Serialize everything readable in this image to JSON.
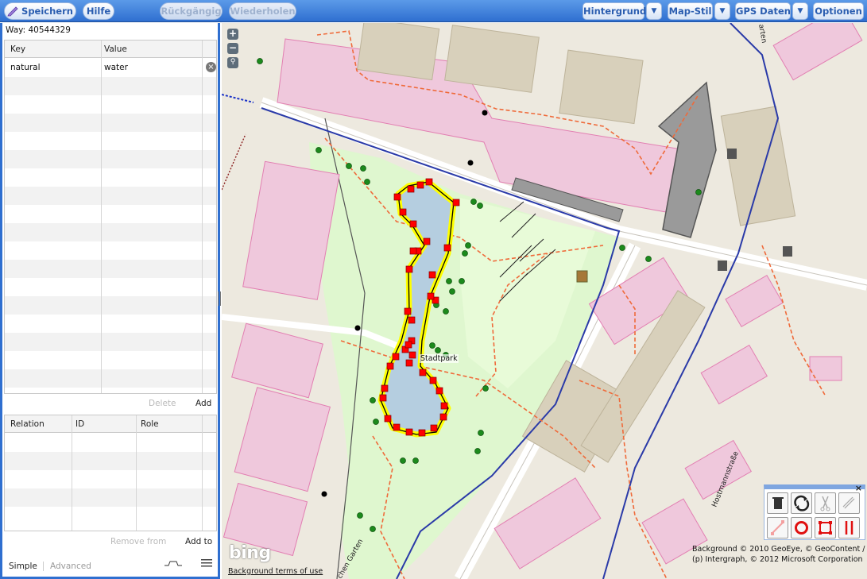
{
  "toolbar": {
    "save_label": "Speichern",
    "help_label": "Hilfe",
    "undo_label": "Rückgängig",
    "redo_label": "Wiederholen",
    "background_label": "Hintergrund",
    "map_style_label": "Map-Stil",
    "gps_label": "GPS Daten",
    "options_label": "Optionen"
  },
  "panel": {
    "way_title": "Way: 40544329",
    "tags": {
      "key_header": "Key",
      "value_header": "Value",
      "rows": [
        {
          "key": "natural",
          "value": "water"
        }
      ],
      "delete_label": "Delete",
      "add_label": "Add"
    },
    "relations": {
      "relation_header": "Relation",
      "id_header": "ID",
      "role_header": "Role",
      "remove_label": "Remove from",
      "add_to_label": "Add to"
    },
    "tabs": {
      "simple": "Simple",
      "advanced": "Advanced"
    }
  },
  "map": {
    "place_label": "Stadtpark",
    "bing_logo": "bing",
    "terms_link": "Background terms of use",
    "attribution": "Background © 2010 GeoEye, © GeoContent / (p) Intergraph, © 2012 Microsoft Corporation",
    "street_labels": [
      "Hostmannstraße",
      "chen Garten",
      "arten"
    ],
    "zoom_in": "+",
    "zoom_out": "−"
  },
  "palette": {
    "close": "×",
    "tools": [
      "trash-icon",
      "reverse-icon",
      "scissors-icon",
      "link-icon",
      "straighten-icon",
      "circularise-icon",
      "orthogonalise-icon",
      "parallel-icon"
    ]
  }
}
